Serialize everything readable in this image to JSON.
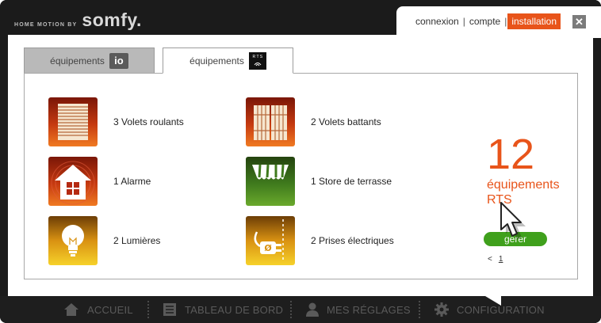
{
  "brand": {
    "tagline": "HOME MOTION BY",
    "name": "somfy."
  },
  "topnav": {
    "links": [
      {
        "label": "connexion"
      },
      {
        "label": "compte"
      },
      {
        "label": "installation",
        "active": true
      }
    ],
    "close": "✕"
  },
  "tabs": [
    {
      "label": "équipements",
      "badge": "io",
      "active": false
    },
    {
      "label": "équipements",
      "badge": "R T S",
      "active": true
    }
  ],
  "devices": [
    {
      "label": "3 Volets roulants",
      "icon": "roller-shutter-icon"
    },
    {
      "label": "2 Volets battants",
      "icon": "swing-shutter-icon"
    },
    {
      "label": "1 Alarme",
      "icon": "alarm-house-icon"
    },
    {
      "label": "1 Store de terrasse",
      "icon": "awning-icon"
    },
    {
      "label": "2 Lumières",
      "icon": "light-bulb-icon"
    },
    {
      "label": "2 Prises électriques",
      "icon": "plug-icon"
    }
  ],
  "summary": {
    "count": "12",
    "label_line1": "équipements",
    "label_line2": "RTS"
  },
  "manage_button": "gérer",
  "pager": {
    "prev": "<",
    "page": "1"
  },
  "bottomnav": [
    {
      "label": "ACCUEIL",
      "icon": "home-icon"
    },
    {
      "label": "TABLEAU DE BORD",
      "icon": "dashboard-icon"
    },
    {
      "label": "MES RÉGLAGES",
      "icon": "user-icon"
    },
    {
      "label": "CONFIGURATION",
      "icon": "gear-icon"
    }
  ],
  "colors": {
    "accent_orange": "#e8541a",
    "button_green": "#3fa01c",
    "frame_dark": "#1b1b1b"
  }
}
